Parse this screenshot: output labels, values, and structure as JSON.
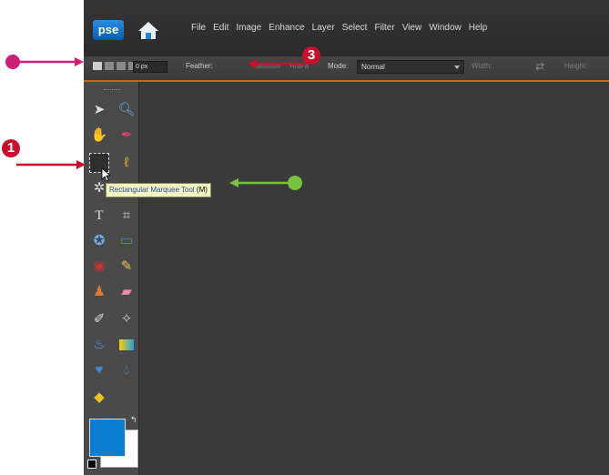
{
  "app": {
    "logo": "pse",
    "menus": [
      "File",
      "Edit",
      "Image",
      "Enhance",
      "Layer",
      "Select",
      "Filter",
      "View",
      "Window",
      "Help"
    ]
  },
  "options": {
    "feather_label": "Feather:",
    "feather_value": "0 px",
    "antialias_label": "Anti-a",
    "mode_label": "Mode:",
    "mode_value": "Normal",
    "width_label": "Width:",
    "height_label": "Height:"
  },
  "tooltip": {
    "text": "Rectangular Marquee Tool",
    "shortcut": "(M)"
  },
  "annotations": {
    "step1": "1",
    "step3": "3"
  },
  "colors": {
    "foreground": "#0a7ed2",
    "background": "#ffffff",
    "accent": "#c8642a",
    "callout_red": "#c8102e",
    "callout_magenta": "#cc1f78",
    "callout_green": "#7ac143"
  },
  "tools": [
    "move-icon",
    "zoom-icon",
    "hand-icon",
    "eyedropper-icon",
    "rectangular-marquee-icon",
    "lasso-icon",
    "magic-wand-icon",
    "brush-select-icon",
    "type-icon",
    "crop-icon",
    "cookie-cutter-icon",
    "straighten-icon",
    "red-eye-icon",
    "spot-healing-icon",
    "clone-stamp-icon",
    "eraser-icon",
    "brush-icon",
    "smart-brush-icon",
    "paint-bucket-icon",
    "gradient-icon",
    "shape-icon",
    "blur-icon",
    "sponge-icon"
  ]
}
